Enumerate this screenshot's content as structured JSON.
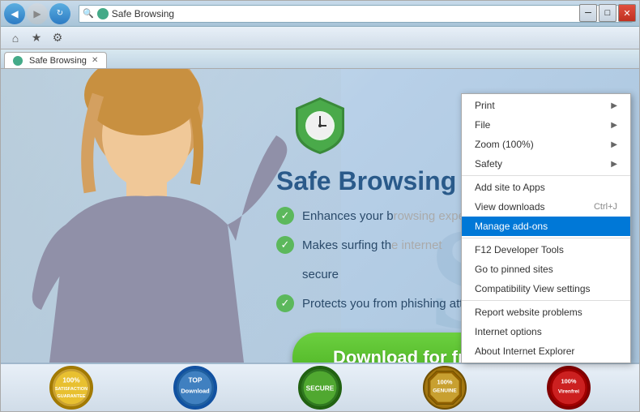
{
  "browser": {
    "title": "Safe Browsing",
    "back_btn": "◀",
    "forward_btn": "▶",
    "refresh_icon": "↻",
    "address": "Safe Browsing",
    "tab_label": "Safe Browsing",
    "tab_close": "✕",
    "win_min": "─",
    "win_max": "□",
    "win_close": "✕",
    "toolbar_home": "⌂",
    "toolbar_star": "★",
    "toolbar_gear": "⚙"
  },
  "webpage": {
    "heading": "Safe Brows",
    "watermark": "SB",
    "features": [
      {
        "text": "Enhances your b..."
      },
      {
        "text": "Makes surfing th..."
      },
      {
        "text": "secure"
      },
      {
        "text": "Protects you from phishing attacts"
      }
    ],
    "download_btn": "Download for free"
  },
  "badges": [
    {
      "label": "100%\nGUARANTEE",
      "id": "badge-guarantee"
    },
    {
      "label": "TOP\nDownload",
      "id": "badge-top-download"
    },
    {
      "label": "SECURE",
      "id": "badge-secure"
    },
    {
      "label": "100%\nGENUINE",
      "id": "badge-genuine"
    },
    {
      "label": "100%\nVirenfrei",
      "id": "badge-virenfrei"
    }
  ],
  "context_menu": {
    "items": [
      {
        "label": "Print",
        "has_arrow": true,
        "shortcut": "",
        "highlighted": false
      },
      {
        "label": "File",
        "has_arrow": true,
        "shortcut": "",
        "highlighted": false
      },
      {
        "label": "Zoom (100%)",
        "has_arrow": true,
        "shortcut": "",
        "highlighted": false
      },
      {
        "label": "Safety",
        "has_arrow": true,
        "shortcut": "",
        "highlighted": false
      },
      {
        "separator": true
      },
      {
        "label": "Add site to Apps",
        "has_arrow": false,
        "shortcut": "",
        "highlighted": false
      },
      {
        "label": "View downloads",
        "has_arrow": false,
        "shortcut": "Ctrl+J",
        "highlighted": false
      },
      {
        "label": "Manage add-ons",
        "has_arrow": false,
        "shortcut": "",
        "highlighted": true
      },
      {
        "separator": true
      },
      {
        "label": "F12 Developer Tools",
        "has_arrow": false,
        "shortcut": "",
        "highlighted": false
      },
      {
        "label": "Go to pinned sites",
        "has_arrow": false,
        "shortcut": "",
        "highlighted": false
      },
      {
        "label": "Compatibility View settings",
        "has_arrow": false,
        "shortcut": "",
        "highlighted": false
      },
      {
        "separator": true
      },
      {
        "label": "Report website problems",
        "has_arrow": false,
        "shortcut": "",
        "highlighted": false
      },
      {
        "label": "Internet options",
        "has_arrow": false,
        "shortcut": "",
        "highlighted": false
      },
      {
        "label": "About Internet Explorer",
        "has_arrow": false,
        "shortcut": "",
        "highlighted": false
      }
    ]
  }
}
